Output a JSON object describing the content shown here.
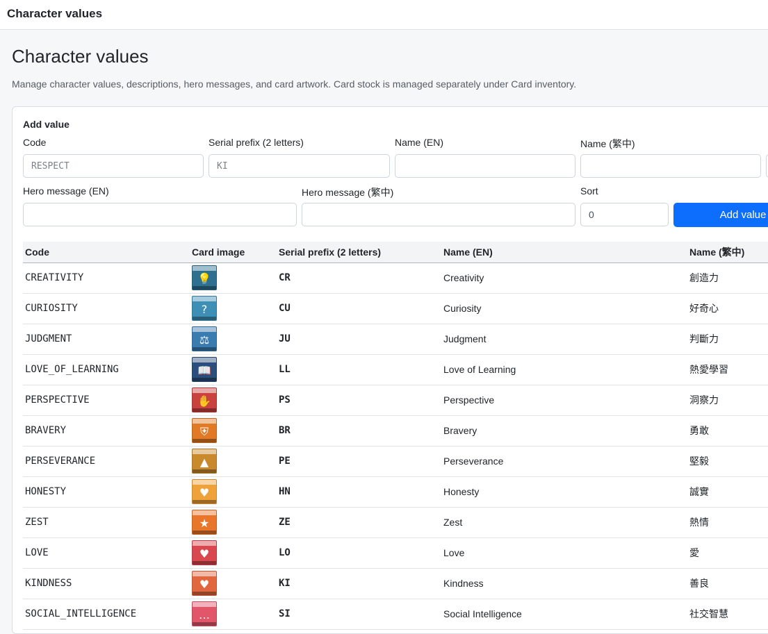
{
  "app": {
    "title": "Character values"
  },
  "page": {
    "title": "Character values",
    "subtitle": "Manage character values, descriptions, hero messages, and card artwork. Card stock is managed separately under Card inventory."
  },
  "form": {
    "title": "Add value",
    "code": {
      "label": "Code",
      "placeholder": "RESPECT",
      "value": ""
    },
    "serial_prefix": {
      "label": "Serial prefix (2 letters)",
      "placeholder": "KI",
      "value": ""
    },
    "name_en": {
      "label": "Name (EN)",
      "value": ""
    },
    "name_zh": {
      "label": "Name (繁中)",
      "value": ""
    },
    "hero_en": {
      "label": "Hero message (EN)",
      "value": ""
    },
    "hero_zh": {
      "label": "Hero message (繁中)",
      "value": ""
    },
    "sort": {
      "label": "Sort",
      "value": "0"
    },
    "add_button": "Add value",
    "accent_color": "#0d6efd"
  },
  "table": {
    "headers": [
      "Code",
      "Card image",
      "Serial prefix (2 letters)",
      "Name (EN)",
      "Name (繁中)"
    ],
    "rows": [
      {
        "code": "CREATIVITY",
        "serial": "CR",
        "name_en": "Creativity",
        "name_zh": "創造力",
        "card_color": "#2f6f8f",
        "card_icon": "lightbulb-icon",
        "glyph": "💡"
      },
      {
        "code": "CURIOSITY",
        "serial": "CU",
        "name_en": "Curiosity",
        "name_zh": "好奇心",
        "card_color": "#3e8fb6",
        "card_icon": "question-icon",
        "glyph": "?"
      },
      {
        "code": "JUDGMENT",
        "serial": "JU",
        "name_en": "Judgment",
        "name_zh": "判斷力",
        "card_color": "#3a7bb0",
        "card_icon": "scales-icon",
        "glyph": "⚖"
      },
      {
        "code": "LOVE_OF_LEARNING",
        "serial": "LL",
        "name_en": "Love of Learning",
        "name_zh": "熱愛學習",
        "card_color": "#2b4f7c",
        "card_icon": "book-icon",
        "glyph": "📖"
      },
      {
        "code": "PERSPECTIVE",
        "serial": "PS",
        "name_en": "Perspective",
        "name_zh": "洞察力",
        "card_color": "#c9423f",
        "card_icon": "handshake-icon",
        "glyph": "✋"
      },
      {
        "code": "BRAVERY",
        "serial": "BR",
        "name_en": "Bravery",
        "name_zh": "勇敢",
        "card_color": "#e07a26",
        "card_icon": "shield-icon",
        "glyph": "⛨"
      },
      {
        "code": "PERSEVERANCE",
        "serial": "PE",
        "name_en": "Perseverance",
        "name_zh": "堅毅",
        "card_color": "#c98a2e",
        "card_icon": "mountain-icon",
        "glyph": "▲"
      },
      {
        "code": "HONESTY",
        "serial": "HN",
        "name_en": "Honesty",
        "name_zh": "誠實",
        "card_color": "#f0a23a",
        "card_icon": "magnifier-heart-icon",
        "glyph": "♥"
      },
      {
        "code": "ZEST",
        "serial": "ZE",
        "name_en": "Zest",
        "name_zh": "熱情",
        "card_color": "#e8772b",
        "card_icon": "star-burst-icon",
        "glyph": "★"
      },
      {
        "code": "LOVE",
        "serial": "LO",
        "name_en": "Love",
        "name_zh": "愛",
        "card_color": "#d9474f",
        "card_icon": "heart-icon",
        "glyph": "♥"
      },
      {
        "code": "KINDNESS",
        "serial": "KI",
        "name_en": "Kindness",
        "name_zh": "善良",
        "card_color": "#e0673e",
        "card_icon": "heart-hand-icon",
        "glyph": "♥"
      },
      {
        "code": "SOCIAL_INTELLIGENCE",
        "serial": "SI",
        "name_en": "Social Intelligence",
        "name_zh": "社交智慧",
        "card_color": "#e2566a",
        "card_icon": "speech-bubble-icon",
        "glyph": "…"
      }
    ]
  }
}
